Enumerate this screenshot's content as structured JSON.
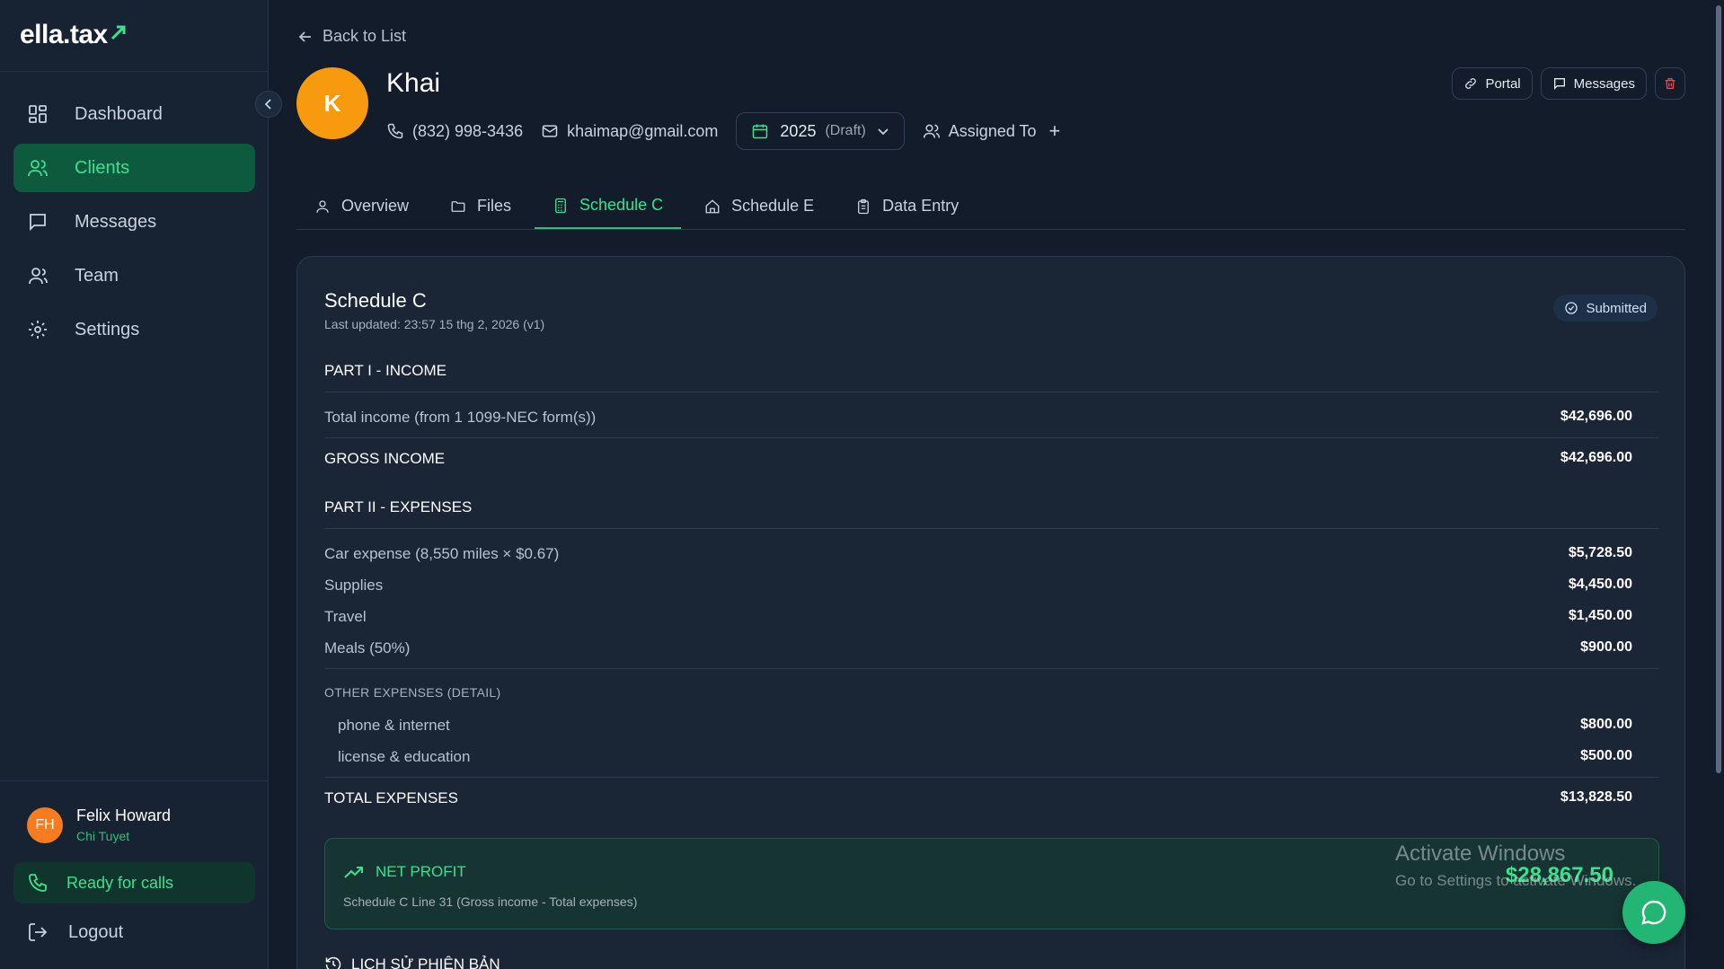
{
  "brand": {
    "logo_text": "ella.tax"
  },
  "sidebar": {
    "items": [
      {
        "label": "Dashboard",
        "icon": "dashboard-icon"
      },
      {
        "label": "Clients",
        "icon": "users-icon",
        "active": true
      },
      {
        "label": "Messages",
        "icon": "message-icon"
      },
      {
        "label": "Team",
        "icon": "team-icon"
      },
      {
        "label": "Settings",
        "icon": "gear-icon"
      }
    ],
    "user": {
      "initials": "FH",
      "name": "Felix Howard",
      "subtitle": "Chi Tuyet"
    },
    "ready_label": "Ready for calls",
    "logout_label": "Logout"
  },
  "header": {
    "back_label": "Back to List",
    "client": {
      "initial": "K",
      "name": "Khai",
      "phone": "(832) 998-3436",
      "email": "khaimap@gmail.com",
      "year": "2025",
      "year_status": "(Draft)",
      "assigned_label": "Assigned To"
    },
    "actions": {
      "portal": "Portal",
      "messages": "Messages"
    }
  },
  "tabs": [
    {
      "label": "Overview",
      "icon": "user-icon"
    },
    {
      "label": "Files",
      "icon": "folder-icon"
    },
    {
      "label": "Schedule C",
      "icon": "calculator-icon",
      "active": true
    },
    {
      "label": "Schedule E",
      "icon": "home-icon"
    },
    {
      "label": "Data Entry",
      "icon": "clipboard-icon"
    }
  ],
  "schedule": {
    "title": "Schedule C",
    "updated": "Last updated: 23:57 15 thg 2, 2026 (v1)",
    "status": "Submitted",
    "part1": {
      "heading": "PART I - INCOME",
      "rows": [
        {
          "label": "Total income (from 1 1099-NEC form(s))",
          "value": "$42,696.00"
        }
      ],
      "gross_label": "GROSS INCOME",
      "gross_value": "$42,696.00"
    },
    "part2": {
      "heading": "PART II - EXPENSES",
      "rows": [
        {
          "label": "Car expense (8,550 miles × $0.67)",
          "value": "$5,728.50"
        },
        {
          "label": "Supplies",
          "value": "$4,450.00"
        },
        {
          "label": "Travel",
          "value": "$1,450.00"
        },
        {
          "label": "Meals (50%)",
          "value": "$900.00"
        }
      ],
      "other_heading": "OTHER EXPENSES (DETAIL)",
      "other_rows": [
        {
          "label": "phone & internet",
          "value": "$800.00"
        },
        {
          "label": "license & education",
          "value": "$500.00"
        }
      ],
      "total_label": "TOTAL EXPENSES",
      "total_value": "$13,828.50"
    },
    "net_profit": {
      "label": "NET PROFIT",
      "sub": "Schedule C Line 31 (Gross income - Total expenses)",
      "value": "$28,867.50"
    },
    "history_heading": "LỊCH SỬ PHIÊN BẢN"
  },
  "watermark": {
    "line1": "Activate Windows",
    "line2": "Go to Settings to activate Windows."
  },
  "colors": {
    "accent": "#3ee08f",
    "active_bg": "#0e5a3f",
    "avatar_client": "#f79a0e",
    "avatar_user": "#f57c1f",
    "danger": "#e5484d"
  }
}
